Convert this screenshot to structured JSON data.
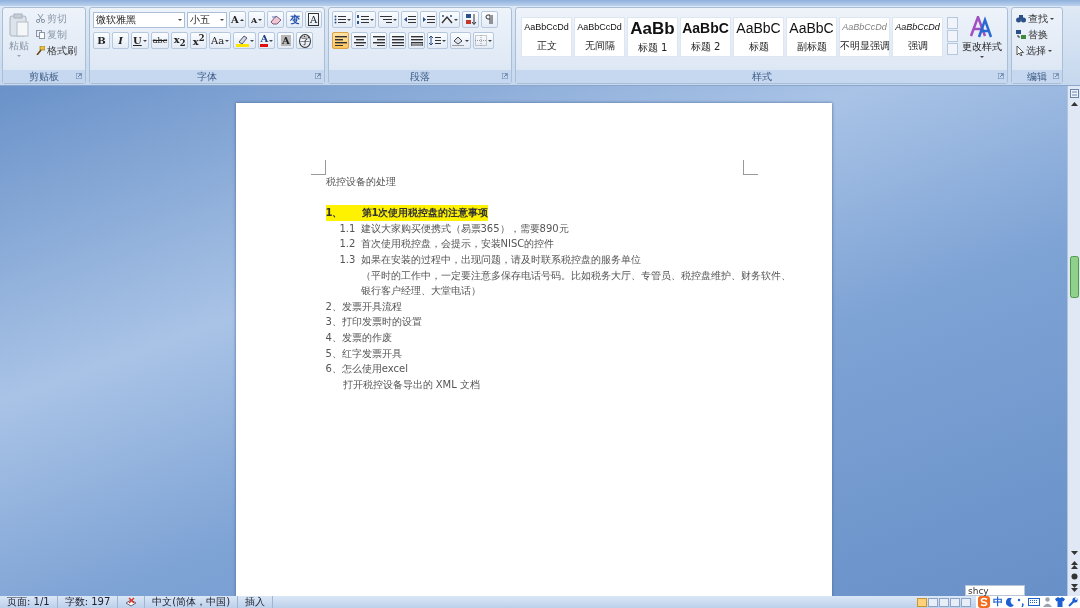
{
  "ribbon": {
    "clipboard": {
      "paste": "粘贴",
      "cut": "剪切",
      "copy": "复制",
      "format_painter": "格式刷",
      "label": "剪贴板"
    },
    "font": {
      "font_name": "微软雅黑",
      "font_size": "小五",
      "label": "字体",
      "row1": [
        {
          "kind": "grow",
          "glyph": "A"
        },
        {
          "kind": "shrink",
          "glyph": "A"
        },
        {
          "kind": "clear"
        },
        {
          "kind": "phonetic",
          "glyph": "变"
        },
        {
          "kind": "border",
          "glyph": "A"
        }
      ],
      "row2": [
        {
          "kind": "bold",
          "glyph": "B"
        },
        {
          "kind": "italic",
          "glyph": "I"
        },
        {
          "kind": "underline",
          "glyph": "U"
        },
        {
          "kind": "strike",
          "glyph": "abc"
        },
        {
          "kind": "sub",
          "glyph": "x$_{2}$"
        },
        {
          "kind": "sup",
          "glyph": "x$^{2}$"
        },
        {
          "kind": "case",
          "glyph": "Aa"
        },
        {
          "kind": "highlight"
        },
        {
          "kind": "color",
          "glyph": "A"
        },
        {
          "kind": "shade",
          "glyph": "A"
        },
        {
          "kind": "enclose",
          "glyph": "字"
        }
      ]
    },
    "paragraph": {
      "label": "段落",
      "alignments": [
        {
          "selected": true
        },
        {
          "selected": false
        },
        {
          "selected": false
        },
        {
          "selected": false
        },
        {
          "selected": false
        }
      ]
    },
    "styles": {
      "label": "样式",
      "change_styles": "更改样式",
      "items": [
        {
          "kind": "normal",
          "preview": "AaBbCcDd",
          "name": "正文"
        },
        {
          "kind": "normal",
          "preview": "AaBbCcDd",
          "name": "无间隔"
        },
        {
          "kind": "h1",
          "preview": "AaBb",
          "name": "标题 1"
        },
        {
          "kind": "h2",
          "preview": "AaBbC",
          "name": "标题 2"
        },
        {
          "kind": "title",
          "preview": "AaBbC",
          "name": "标题"
        },
        {
          "kind": "title",
          "preview": "AaBbC",
          "name": "副标题"
        },
        {
          "kind": "subtle",
          "preview": "AaBbCcDd",
          "name": "不明显强调"
        },
        {
          "kind": "emphasis",
          "preview": "AaBbCcDd",
          "name": "强调"
        }
      ]
    },
    "editing": {
      "label": "编辑",
      "find": "查找",
      "replace": "替换",
      "select": "选择"
    }
  },
  "document": {
    "lines": [
      {
        "kind": "title",
        "text": "税控设备的处理"
      },
      {
        "kind": "blank"
      },
      {
        "kind": "heading",
        "number": "1、",
        "text": "第1次使用税控盘的注意事项"
      },
      {
        "kind": "sub",
        "number": "1.1",
        "text": "建议大家购买便携式（易票365），需要890元"
      },
      {
        "kind": "sub",
        "number": "1.2",
        "text": "首次使用税控盘，会提示，安装NISC的控件"
      },
      {
        "kind": "sub",
        "number": "1.3",
        "text": "如果在安装的过程中，出现问题，请及时联系税控盘的服务单位"
      },
      {
        "kind": "continuation",
        "text": "（平时的工作中，一定要注意多保存电话号码。比如税务大厅、专管员、税控盘维护、财务软件、"
      },
      {
        "kind": "continuation",
        "text": "银行客户经理、大堂电话）"
      },
      {
        "kind": "item",
        "text": "2、发票开具流程"
      },
      {
        "kind": "item",
        "text": "3、打印发票时的设置"
      },
      {
        "kind": "item",
        "text": "4、发票的作废"
      },
      {
        "kind": "item",
        "text": "5、红字发票开具"
      },
      {
        "kind": "item",
        "text": "6、怎么使用excel"
      },
      {
        "kind": "note",
        "text": "打开税控设备导出的 XML 文档"
      }
    ]
  },
  "ime_input": "shcy",
  "status_bar": {
    "page": "页面: 1/1",
    "words": "字数: 197",
    "language": "中文(简体，中国)",
    "mode": "插入",
    "views": [
      {
        "selected": true
      },
      {
        "selected": false
      },
      {
        "selected": false
      },
      {
        "selected": false
      },
      {
        "selected": false
      }
    ],
    "ime_mode": "中"
  }
}
